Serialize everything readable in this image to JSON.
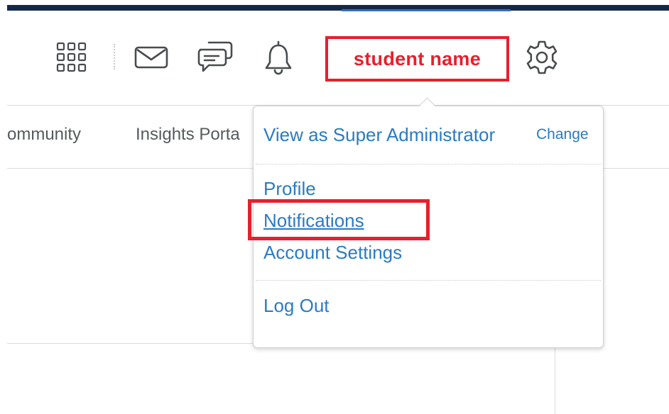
{
  "header": {
    "user_name": "student name",
    "icons": [
      "app-launcher-icon",
      "mail-icon",
      "chat-icon",
      "bell-icon",
      "gear-icon"
    ]
  },
  "nav": {
    "items": [
      "ommunity",
      "Insights Porta"
    ]
  },
  "dropdown": {
    "view_as_label": "View as Super Administrator",
    "change_label": "Change",
    "items": [
      "Profile",
      "Notifications",
      "Account Settings"
    ],
    "logout_label": "Log Out"
  },
  "colors": {
    "header_bar": "#14294a",
    "link": "#2a7bc4",
    "highlight": "#e6202c",
    "icon": "#494c4e"
  }
}
